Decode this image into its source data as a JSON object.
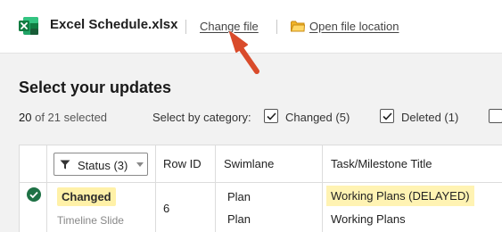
{
  "header": {
    "file_name": "Excel Schedule.xlsx",
    "change_file_label": "Change file",
    "open_location_label": "Open file location"
  },
  "colors": {
    "excel_green": "#1e7145",
    "highlight_yellow": "#fff1a8",
    "arrow_red": "#d94b2b",
    "check_green": "#1e7145"
  },
  "main": {
    "title": "Select your updates",
    "selected_count": "20",
    "selected_suffix": "of 21 selected",
    "category_label": "Select by category:",
    "categories": [
      {
        "label": "Changed (5)",
        "checked": true
      },
      {
        "label": "Deleted (1)",
        "checked": true
      },
      {
        "label": "",
        "checked": false
      }
    ]
  },
  "table": {
    "status_filter_label": "Status (3)",
    "columns": [
      "Row ID",
      "Swimlane",
      "Task/Milestone Title"
    ],
    "rows": [
      {
        "status": "Changed",
        "sub_status": "Timeline Slide",
        "row_id": "6",
        "swimlane_new": "Plan",
        "swimlane_old": "Plan",
        "title_new": "Working Plans (DELAYED)",
        "title_old": "Working Plans"
      }
    ]
  }
}
